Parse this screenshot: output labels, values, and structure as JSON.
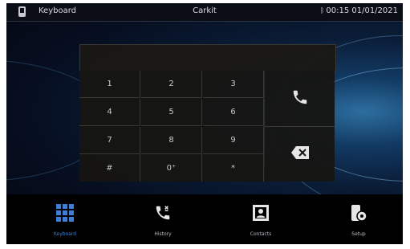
{
  "status_bar": {
    "icon": "phone-icon",
    "title": "Keyboard",
    "carrier": "Carkit",
    "bluetooth_icon": "bluetooth-icon",
    "datetime": "00:15 01/01/2021"
  },
  "dialer": {
    "display_value": "",
    "keys": [
      {
        "label": "1"
      },
      {
        "label": "2"
      },
      {
        "label": "3"
      },
      {
        "label": "4"
      },
      {
        "label": "5"
      },
      {
        "label": "6"
      },
      {
        "label": "7"
      },
      {
        "label": "8"
      },
      {
        "label": "9"
      },
      {
        "label": "#"
      },
      {
        "label": "0⁺"
      },
      {
        "label": "*"
      }
    ],
    "call_icon": "phone-call-icon",
    "delete_icon": "backspace-icon"
  },
  "bottom_nav": [
    {
      "label": "Keyboard",
      "icon": "keypad-grid-icon",
      "active": true
    },
    {
      "label": "History",
      "icon": "call-history-icon",
      "active": false
    },
    {
      "label": "Contacts",
      "icon": "contacts-book-icon",
      "active": false
    },
    {
      "label": "Setup",
      "icon": "phone-settings-icon",
      "active": false
    }
  ],
  "colors": {
    "accent": "#3d7fd6",
    "background": "#060d1e"
  }
}
